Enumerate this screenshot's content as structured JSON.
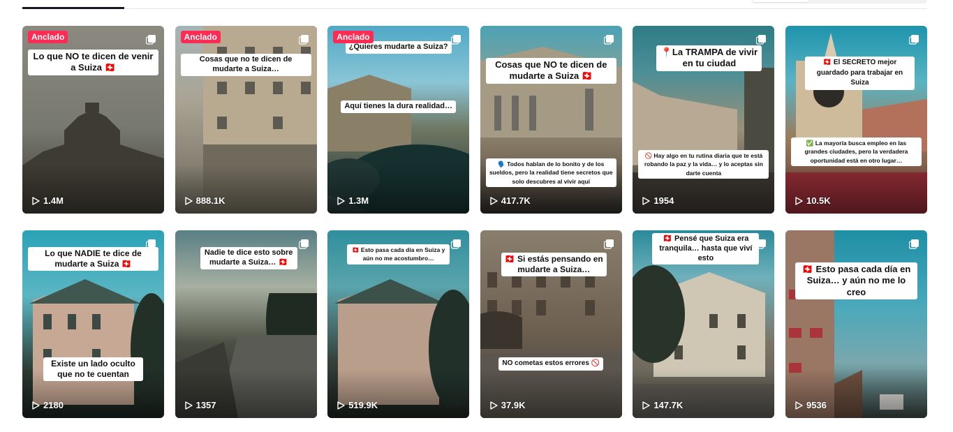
{
  "header": {
    "active_tab": "",
    "toggle_segment": ""
  },
  "icons": {
    "pin_badge": "pinned-badge",
    "multi_photo": "carousel-icon",
    "play": "play-icon"
  },
  "colors": {
    "pin_badge": "#fe2c55",
    "text_dark": "#161823"
  },
  "videos": [
    {
      "pinned": true,
      "pin_label": "Anclado",
      "caption": "Lo que NO te dicen de venir a Suiza 🇨🇭",
      "views": "1.4M"
    },
    {
      "pinned": true,
      "pin_label": "Anclado",
      "caption": "Cosas que no te dicen de mudarte a Suiza…",
      "views": "888.1K"
    },
    {
      "pinned": true,
      "pin_label": "Anclado",
      "caption": "¿Quieres mudarte a Suiza?",
      "caption2": "Aquí tienes la dura realidad…",
      "views": "1.3M"
    },
    {
      "pinned": false,
      "caption": "Cosas que NO te dicen de mudarte a Suiza 🇨🇭",
      "caption2": "🗣️ Todos hablan de lo bonito y de los sueldos, pero la realidad tiene secretos que solo descubres al vivir aquí",
      "views": "417.7K"
    },
    {
      "pinned": false,
      "caption": "📍La TRAMPA de vivir en tu ciudad",
      "caption2": "🚫 Hay algo en tu rutina diaria que te está robando la paz y la vida… y lo aceptas sin darte cuenta",
      "views": "1954"
    },
    {
      "pinned": false,
      "caption": "🇨🇭 El SECRETO mejor guardado para trabajar en Suiza",
      "caption2": "✅ La mayoría busca empleo en las grandes ciudades, pero la verdadera oportunidad está en otro lugar…",
      "views": "10.5K"
    },
    {
      "pinned": false,
      "caption": "Lo que NADIE te dice de mudarte a Suiza 🇨🇭",
      "caption2": "Existe un lado oculto que no te cuentan",
      "views": "2180"
    },
    {
      "pinned": false,
      "caption": "Nadie te dice esto sobre mudarte a Suiza… 🇨🇭",
      "views": "1357"
    },
    {
      "pinned": false,
      "caption": "🇨🇭 Esto pasa cada día en Suiza y aún no me acostumbro…",
      "views": "519.9K"
    },
    {
      "pinned": false,
      "caption": "🇨🇭 Si estás pensando en mudarte a Suiza…",
      "caption2": "NO cometas estos errores 🚫",
      "views": "37.9K"
    },
    {
      "pinned": false,
      "caption": "🇨🇭 Pensé que Suiza era tranquila… hasta que viví esto",
      "views": "147.7K"
    },
    {
      "pinned": false,
      "caption": "🇨🇭 Esto pasa cada día en Suiza… y aún no me lo creo",
      "views": "9536"
    }
  ]
}
